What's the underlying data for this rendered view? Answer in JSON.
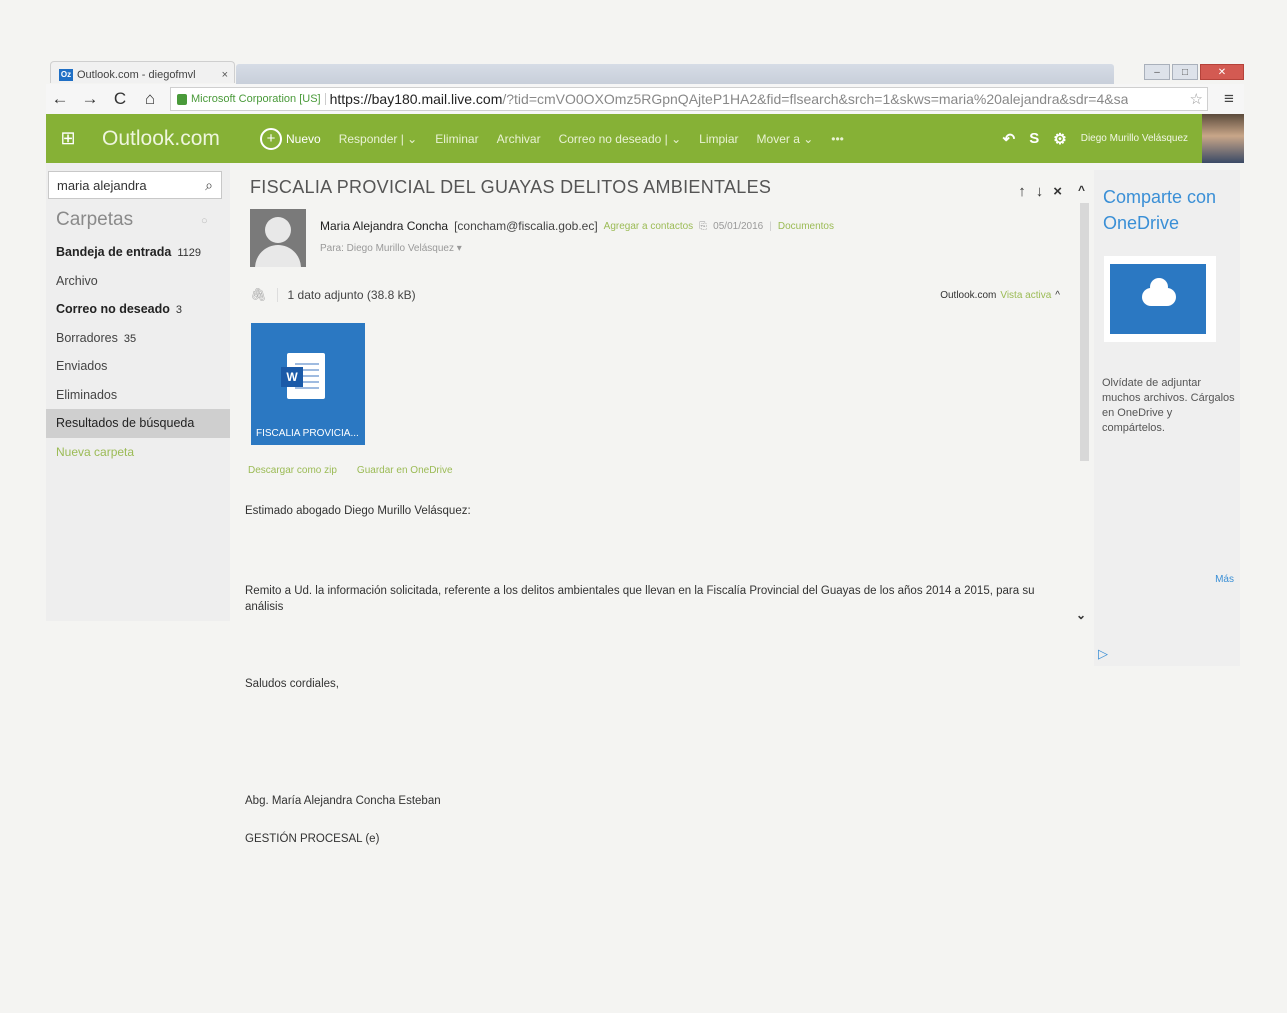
{
  "browser": {
    "tab_title": "Outlook.com - diegofmvl",
    "tab_close": "×",
    "back": "←",
    "forward": "→",
    "reload": "C",
    "home": "⌂",
    "ev_label": "Microsoft Corporation [US]",
    "url_host": "https://bay180.mail.live.com",
    "url_path": "/?tid=cmVO0OXOmz5RGpnQAjteP1HA2&fid=flsearch&srch=1&skws=maria%20alejandra&sdr=4&sa",
    "star": "☆",
    "menu": "≡"
  },
  "header": {
    "waffle": "⊞",
    "brand": "Outlook.com",
    "new_icon": "+",
    "new_label": "Nuevo",
    "commands": [
      "Responder | ⌄",
      "Eliminar",
      "Archivar",
      "Correo no deseado | ⌄",
      "Limpiar",
      "Mover a ⌄",
      "•••"
    ],
    "undo_icon": "↶",
    "skype_icon": "S",
    "gear_icon": "⚙",
    "user_name": "Diego Murillo Velásquez"
  },
  "sidebar": {
    "search_value": "maria alejandra",
    "search_icon": "⌕",
    "folders_title": "Carpetas",
    "refresh_icon": "○",
    "folders": [
      {
        "label": "Bandeja de entrada",
        "count": "1129"
      },
      {
        "label": "Archivo",
        "count": ""
      },
      {
        "label": "Correo no deseado",
        "count": "3"
      },
      {
        "label": "Borradores",
        "count": "35"
      },
      {
        "label": "Enviados",
        "count": ""
      },
      {
        "label": "Eliminados",
        "count": ""
      },
      {
        "label": "Resultados de búsqueda",
        "count": ""
      },
      {
        "label": "Nueva carpeta",
        "count": ""
      }
    ]
  },
  "message": {
    "subject": "FISCALIA PROVICIAL DEL GUAYAS DELITOS AMBIENTALES",
    "nav_up": "↑",
    "nav_down": "↓",
    "close": "×",
    "sender_name": "Maria Alejandra Concha",
    "sender_email": "[concham@fiscalia.gob.ec]",
    "add_contacts": "Agregar a contactos",
    "attach_icon": "⎘",
    "date": "05/01/2016",
    "separator": "|",
    "folder": "Documentos",
    "to_line": "Para: Diego Murillo Velásquez ▾",
    "clip": "🖇",
    "attachment_count": "1 dato adjunto (38.8 kB)",
    "view_provider": "Outlook.com",
    "view_mode": "Vista activa",
    "view_caret": "^",
    "attachment_name": "FISCALIA PROVICIA...",
    "word_letter": "W",
    "download_zip": "Descargar como zip",
    "save_onedrive": "Guardar en OneDrive",
    "body": {
      "greeting": "Estimado abogado Diego Murillo Velásquez:",
      "paragraph": "Remito a Ud. la información solicitada, referente a los delitos ambientales que llevan en la Fiscalía Provincial del Guayas de los años 2014 a 2015, para su análisis",
      "closing": "Saludos cordiales,",
      "signature_name": "Abg. María Alejandra Concha Esteban",
      "signature_title": "GESTIÓN PROCESAL (e)"
    }
  },
  "ad": {
    "scroll_up": "^",
    "scroll_down": "⌄",
    "title": "Comparte con OneDrive",
    "text": "Olvídate de adjuntar muchos archivos. Cárgalos en OneDrive y compártelos.",
    "more": "Más",
    "adchoices": "▷"
  }
}
